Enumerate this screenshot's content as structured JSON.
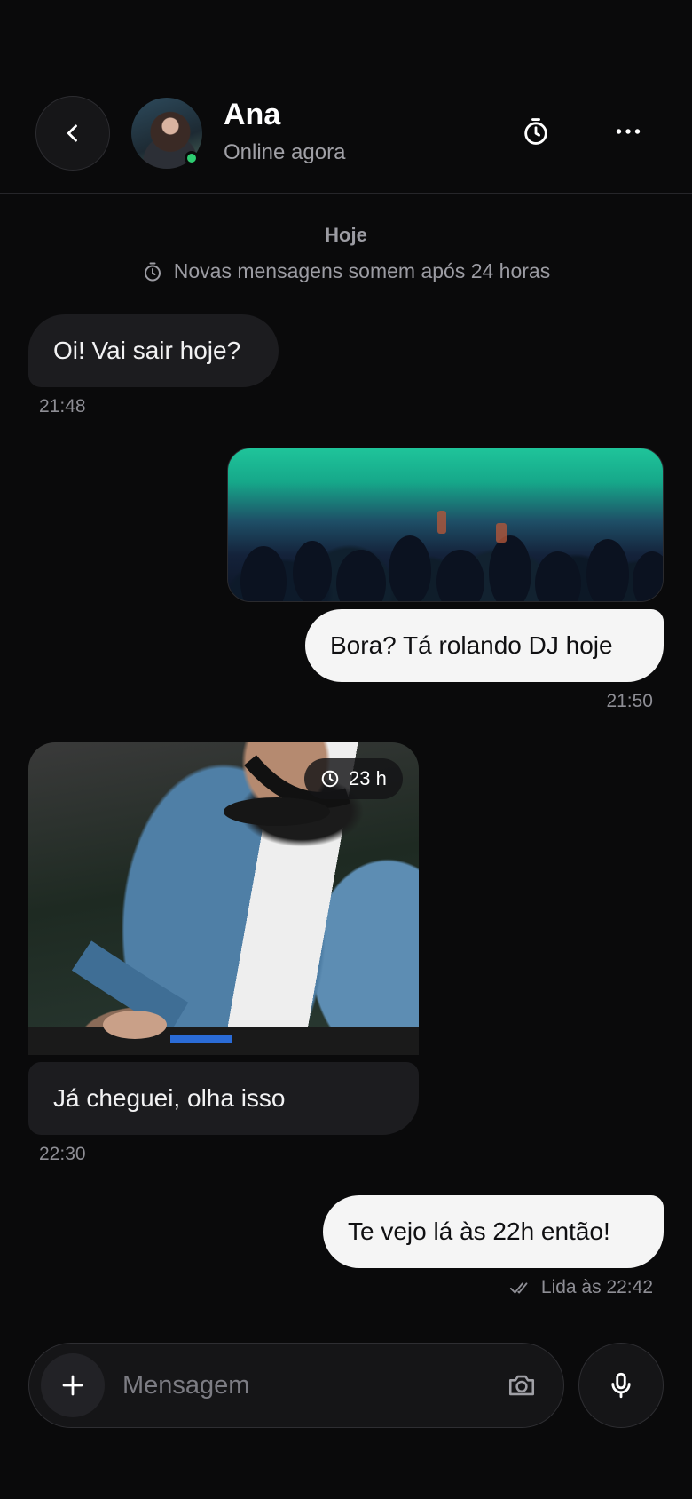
{
  "header": {
    "contact_name": "Ana",
    "contact_status": "Online agora",
    "online_color": "#2ecc71",
    "icons": [
      "chevron-left-icon",
      "timer-icon",
      "more-horizontal-icon"
    ]
  },
  "conversation": {
    "day_label": "Hoje",
    "ephemeral_note": "Novas mensagens somem após 24 horas",
    "messages": [
      {
        "direction": "in",
        "text": "Oi! Vai sair hoje?",
        "time": "21:48"
      },
      {
        "direction": "out",
        "image": "concert-crowd-photo",
        "text": "Bora? Tá rolando DJ hoje",
        "time": "21:50"
      },
      {
        "direction": "in",
        "image": "dj-photo",
        "expiry_badge": "23 h",
        "text": "Já cheguei, olha isso",
        "time": "22:30"
      },
      {
        "direction": "out",
        "text": "Te vejo lá às 22h então!",
        "status": "Lida às 22:42"
      }
    ]
  },
  "composer": {
    "placeholder": "Mensagem",
    "value": "",
    "icons": [
      "plus-icon",
      "camera-icon",
      "microphone-icon"
    ]
  },
  "colors": {
    "background": "#0a0a0b",
    "incoming_bubble": "#1c1c1f",
    "outgoing_bubble": "#f5f5f5"
  }
}
